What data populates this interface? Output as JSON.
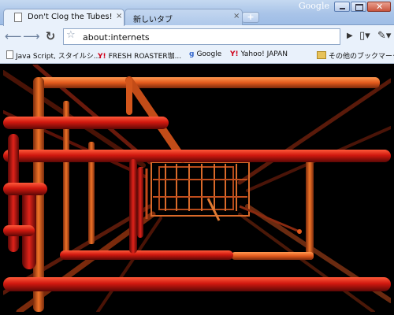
{
  "window": {
    "brand": "Google",
    "controls": {
      "minimize": "minimize",
      "maximize": "maximize",
      "close": "close"
    }
  },
  "tabs": [
    {
      "title": "Don't Clog the Tubes!",
      "active": true,
      "close": "×"
    },
    {
      "title": "新しいタブ",
      "active": false,
      "close": "×"
    }
  ],
  "new_tab_label": "+",
  "toolbar": {
    "back_icon": "arrow-left-icon",
    "forward_icon": "arrow-right-icon",
    "reload_icon": "reload-icon",
    "bookmark_star_icon": "star-icon",
    "address": "about:internets",
    "go_icon": "play-icon",
    "page_menu_icon": "page-menu-icon",
    "tools_menu_icon": "wrench-icon"
  },
  "bookmarks": [
    {
      "label": "Java Script, スタイルシ...",
      "icon": "document-icon"
    },
    {
      "label": "FRESH ROASTER珈...",
      "icon": "yahoo-icon"
    },
    {
      "label": "Google",
      "icon": "google-icon"
    },
    {
      "label": "Yahoo! JAPAN",
      "icon": "yahoo-icon"
    },
    {
      "label": "その他のブックマーク",
      "icon": "folder-icon"
    }
  ],
  "content": {
    "description": "3D pipes screensaver scene",
    "colors": {
      "background": "#000000",
      "pipe_red": "#c4150f",
      "pipe_orange": "#e35a1c",
      "pipe_dark": "#6a1a0c"
    }
  }
}
